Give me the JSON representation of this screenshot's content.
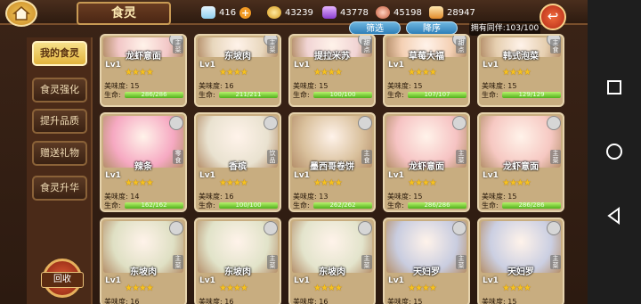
{
  "header": {
    "title": "食灵",
    "resources": [
      {
        "name": "diamond",
        "value": "416"
      },
      {
        "name": "coin",
        "value": "43239"
      },
      {
        "name": "gem",
        "value": "43778"
      },
      {
        "name": "meat",
        "value": "45198"
      },
      {
        "name": "food",
        "value": "28947"
      }
    ],
    "plus": "+",
    "back": "↩"
  },
  "toolbar": {
    "filter_label": "筛选",
    "sort_label": "降序",
    "owned_label": "拥有同伴:103/100"
  },
  "sidebar": {
    "items": [
      {
        "label": "我的食灵",
        "active": true
      },
      {
        "label": "食灵强化",
        "active": false
      },
      {
        "label": "提升品质",
        "active": false
      },
      {
        "label": "赠送礼物",
        "active": false
      },
      {
        "label": "食灵升华",
        "active": false
      }
    ],
    "recycle_label": "回收"
  },
  "cards": [
    {
      "name": "龙虾意面",
      "level": "Lv1",
      "stars": "★★★★",
      "taste": "美味度: 15",
      "hp_label": "生命:",
      "hp": "286/286",
      "hp_frac": 1.0,
      "tag": "主菜",
      "color": "#f2c7c7"
    },
    {
      "name": "东坡肉",
      "level": "Lv1",
      "stars": "★★★★",
      "taste": "美味度: 16",
      "hp_label": "生命:",
      "hp": "211/211",
      "hp_frac": 1.0,
      "tag": "主菜",
      "color": "#e8d7bd"
    },
    {
      "name": "提拉米苏",
      "level": "Lv1",
      "stars": "★★★★",
      "taste": "美味度: 15",
      "hp_label": "生命:",
      "hp": "100/100",
      "hp_frac": 1.0,
      "tag": "甜点",
      "color": "#f1d4d4"
    },
    {
      "name": "草莓大福",
      "level": "Lv1",
      "stars": "★★★★",
      "taste": "美味度: 15",
      "hp_label": "生命:",
      "hp": "107/107",
      "hp_frac": 1.0,
      "tag": "甜点",
      "color": "#f4d0b4"
    },
    {
      "name": "韩式泡菜",
      "level": "Lv1",
      "stars": "★★★★",
      "taste": "美味度: 15",
      "hp_label": "生命:",
      "hp": "129/129",
      "hp_frac": 1.0,
      "tag": "主食",
      "color": "#e6cfb0"
    },
    {
      "name": "辣条",
      "level": "Lv1",
      "stars": "★★★★",
      "taste": "美味度: 14",
      "hp_label": "生命:",
      "hp": "162/162",
      "hp_frac": 1.0,
      "tag": "零食",
      "color": "#f6a9c2"
    },
    {
      "name": "香槟",
      "level": "Lv1",
      "stars": "★★★★",
      "taste": "美味度: 16",
      "hp_label": "生命:",
      "hp": "100/100",
      "hp_frac": 1.0,
      "tag": "饮品",
      "color": "#e9e2d0"
    },
    {
      "name": "墨西哥卷饼",
      "level": "Lv1",
      "stars": "★★★★",
      "taste": "美味度: 13",
      "hp_label": "生命:",
      "hp": "262/262",
      "hp_frac": 1.0,
      "tag": "主食",
      "color": "#d9c09c"
    },
    {
      "name": "龙虾意面",
      "level": "Lv1",
      "stars": "★★★★",
      "taste": "美味度: 15",
      "hp_label": "生命:",
      "hp": "286/286",
      "hp_frac": 1.0,
      "tag": "主菜",
      "color": "#f6c3c3"
    },
    {
      "name": "龙虾意面",
      "level": "Lv1",
      "stars": "★★★★",
      "taste": "美味度: 15",
      "hp_label": "生命:",
      "hp": "286/286",
      "hp_frac": 1.0,
      "tag": "主菜",
      "color": "#f6c8c2"
    },
    {
      "name": "东坡肉",
      "level": "Lv1",
      "stars": "★★★★",
      "taste": "美味度: 16",
      "hp_label": "",
      "hp": "",
      "hp_frac": 1.0,
      "tag": "主菜",
      "color": "#dfe0c4"
    },
    {
      "name": "东坡肉",
      "level": "Lv1",
      "stars": "★★★★",
      "taste": "美味度: 16",
      "hp_label": "",
      "hp": "",
      "hp_frac": 1.0,
      "tag": "主菜",
      "color": "#e1e3c9"
    },
    {
      "name": "东坡肉",
      "level": "Lv1",
      "stars": "★★★★",
      "taste": "美味度: 16",
      "hp_label": "",
      "hp": "",
      "hp_frac": 1.0,
      "tag": "主菜",
      "color": "#e3e4cc"
    },
    {
      "name": "天妇罗",
      "level": "Lv1",
      "stars": "★★★★",
      "taste": "美味度: 15",
      "hp_label": "",
      "hp": "",
      "hp_frac": 1.0,
      "tag": "主菜",
      "color": "#c9cde0"
    },
    {
      "name": "天妇罗",
      "level": "Lv1",
      "stars": "★★★★",
      "taste": "美味度: 15",
      "hp_label": "",
      "hp": "",
      "hp_frac": 1.0,
      "tag": "主菜",
      "color": "#cbcfe2"
    }
  ]
}
